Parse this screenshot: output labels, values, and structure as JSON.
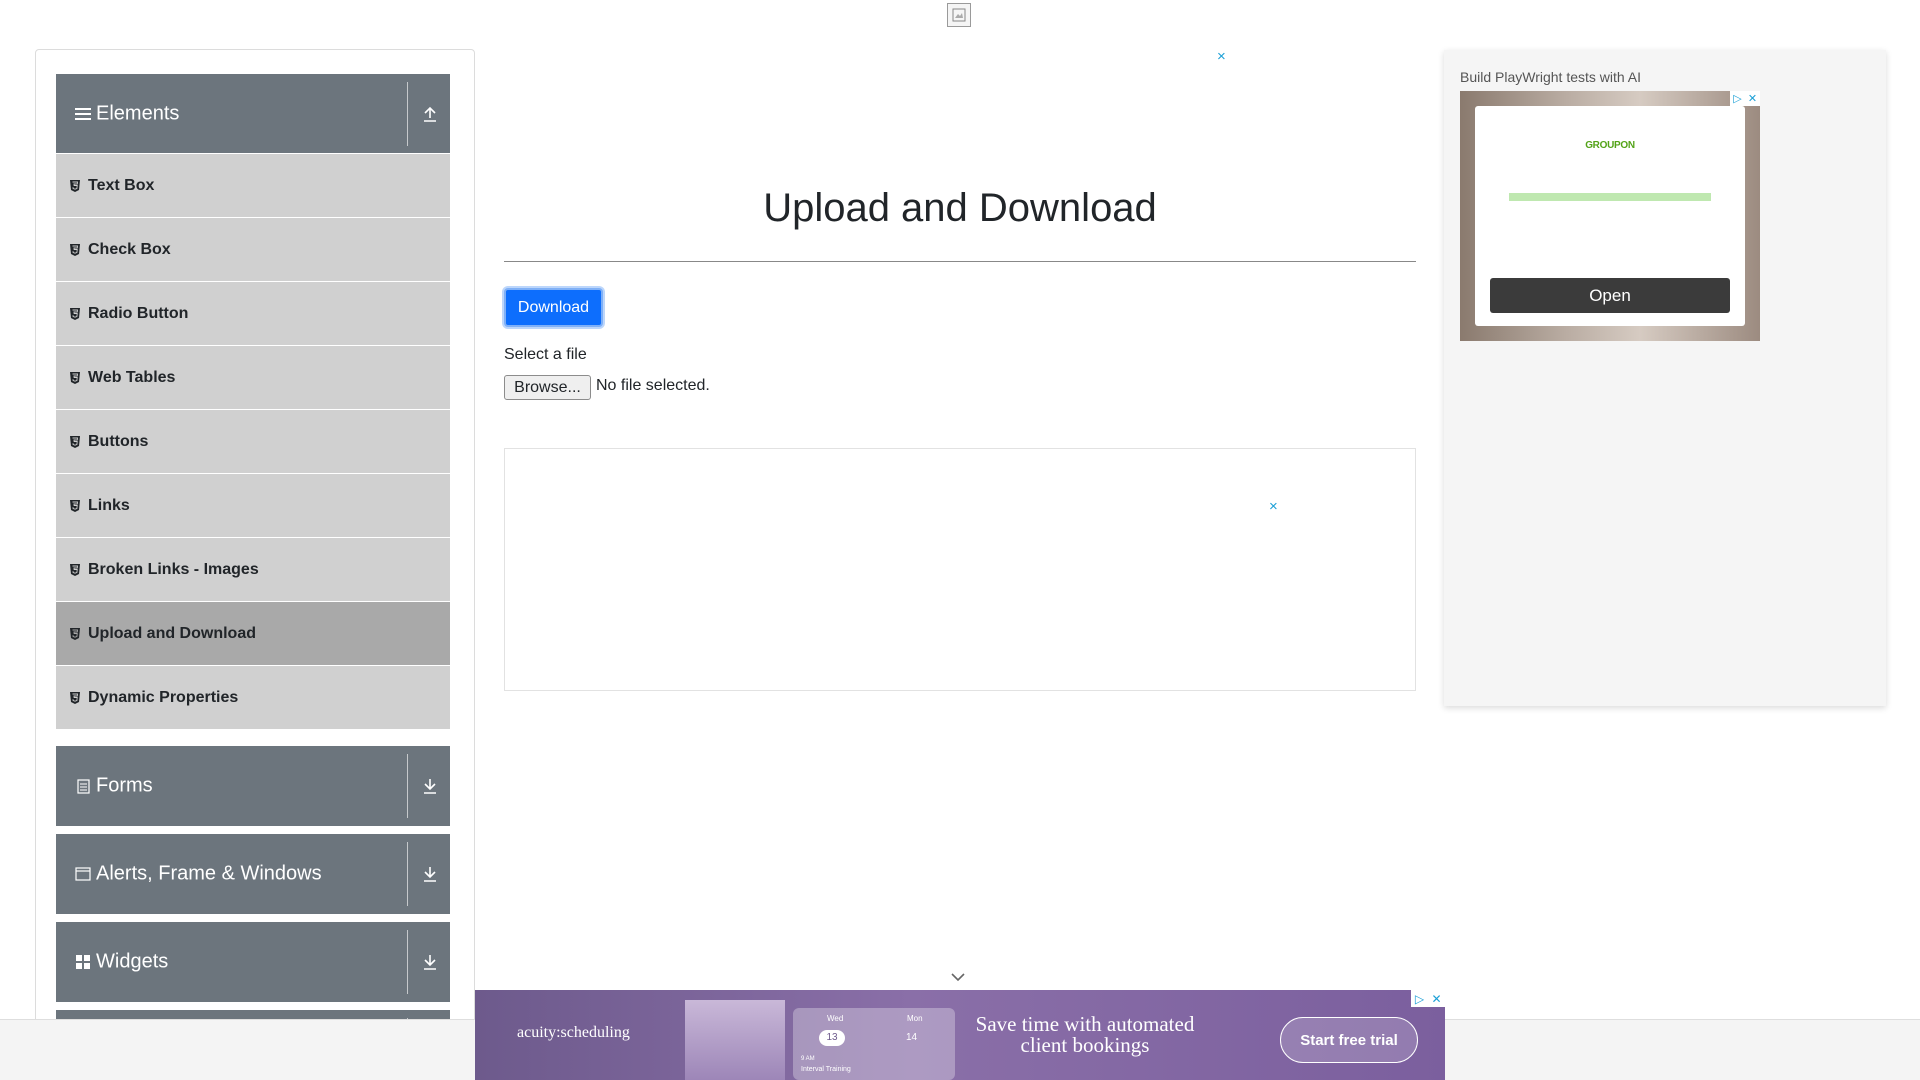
{
  "header": {
    "logo_icon": "broken-image-icon"
  },
  "sidebar": {
    "groups": [
      {
        "title": "Elements",
        "icon": "hamburger-icon",
        "toggle_icon": "collapse-up-icon",
        "expanded": true
      },
      {
        "title": "Forms",
        "icon": "document-icon",
        "toggle_icon": "expand-down-icon",
        "expanded": false
      },
      {
        "title": "Alerts, Frame & Windows",
        "icon": "window-icon",
        "toggle_icon": "expand-down-icon",
        "expanded": false
      },
      {
        "title": "Widgets",
        "icon": "grid-icon",
        "toggle_icon": "expand-down-icon",
        "expanded": false
      }
    ],
    "items": [
      {
        "label": "Text Box",
        "active": false
      },
      {
        "label": "Check Box",
        "active": false
      },
      {
        "label": "Radio Button",
        "active": false
      },
      {
        "label": "Web Tables",
        "active": false
      },
      {
        "label": "Buttons",
        "active": false
      },
      {
        "label": "Links",
        "active": false
      },
      {
        "label": "Broken Links - Images",
        "active": false
      },
      {
        "label": "Upload and Download",
        "active": true
      },
      {
        "label": "Dynamic Properties",
        "active": false
      }
    ]
  },
  "main": {
    "title": "Upload and Download",
    "download_label": "Download",
    "select_label": "Select a file",
    "browse_label": "Browse...",
    "file_status": "No file selected.",
    "ad_close": "×"
  },
  "right_ad": {
    "caption": "Build PlayWright tests with AI",
    "brand": "GROUPON",
    "open_label": "Open",
    "corner_play": "▷",
    "corner_close": "✕"
  },
  "bottom_ad": {
    "brand": "acuity:scheduling",
    "calendar": {
      "day1_name": "Wed",
      "day1_num": "13",
      "day2_name": "Mon",
      "day2_num": "14",
      "time": "9 AM",
      "event": "Interval Training"
    },
    "headline": "Save time with automated client bookings",
    "cta": "Start free trial",
    "corner_play": "▷",
    "corner_close": "✕"
  },
  "colors": {
    "group_header_bg": "#6c757d",
    "menu_item_bg": "#d0d0d0",
    "menu_item_active_bg": "#a9a9a9",
    "primary_button": "#0d6efd",
    "ad_close": "#1a9fd6"
  }
}
